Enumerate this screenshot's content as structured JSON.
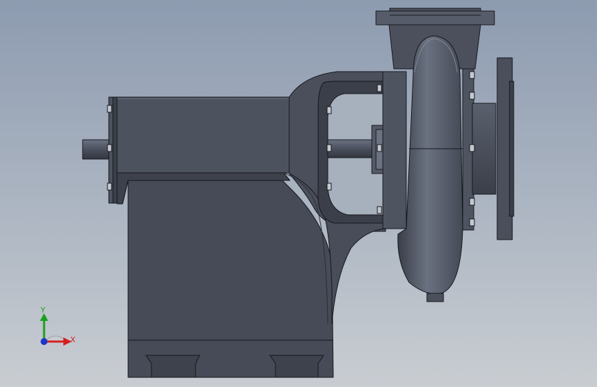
{
  "viewport": {
    "background_top": "#8d9bb0",
    "background_bottom": "#c9cdd2"
  },
  "model": {
    "body_color": "#4a4f5c",
    "edge_color": "#15171c",
    "highlight_color": "#6f7686"
  },
  "triad": {
    "y_label": "Y",
    "x_label": "X",
    "y_color": "#1aa01a",
    "x_color": "#d42020",
    "z_color": "#1f33c8"
  }
}
